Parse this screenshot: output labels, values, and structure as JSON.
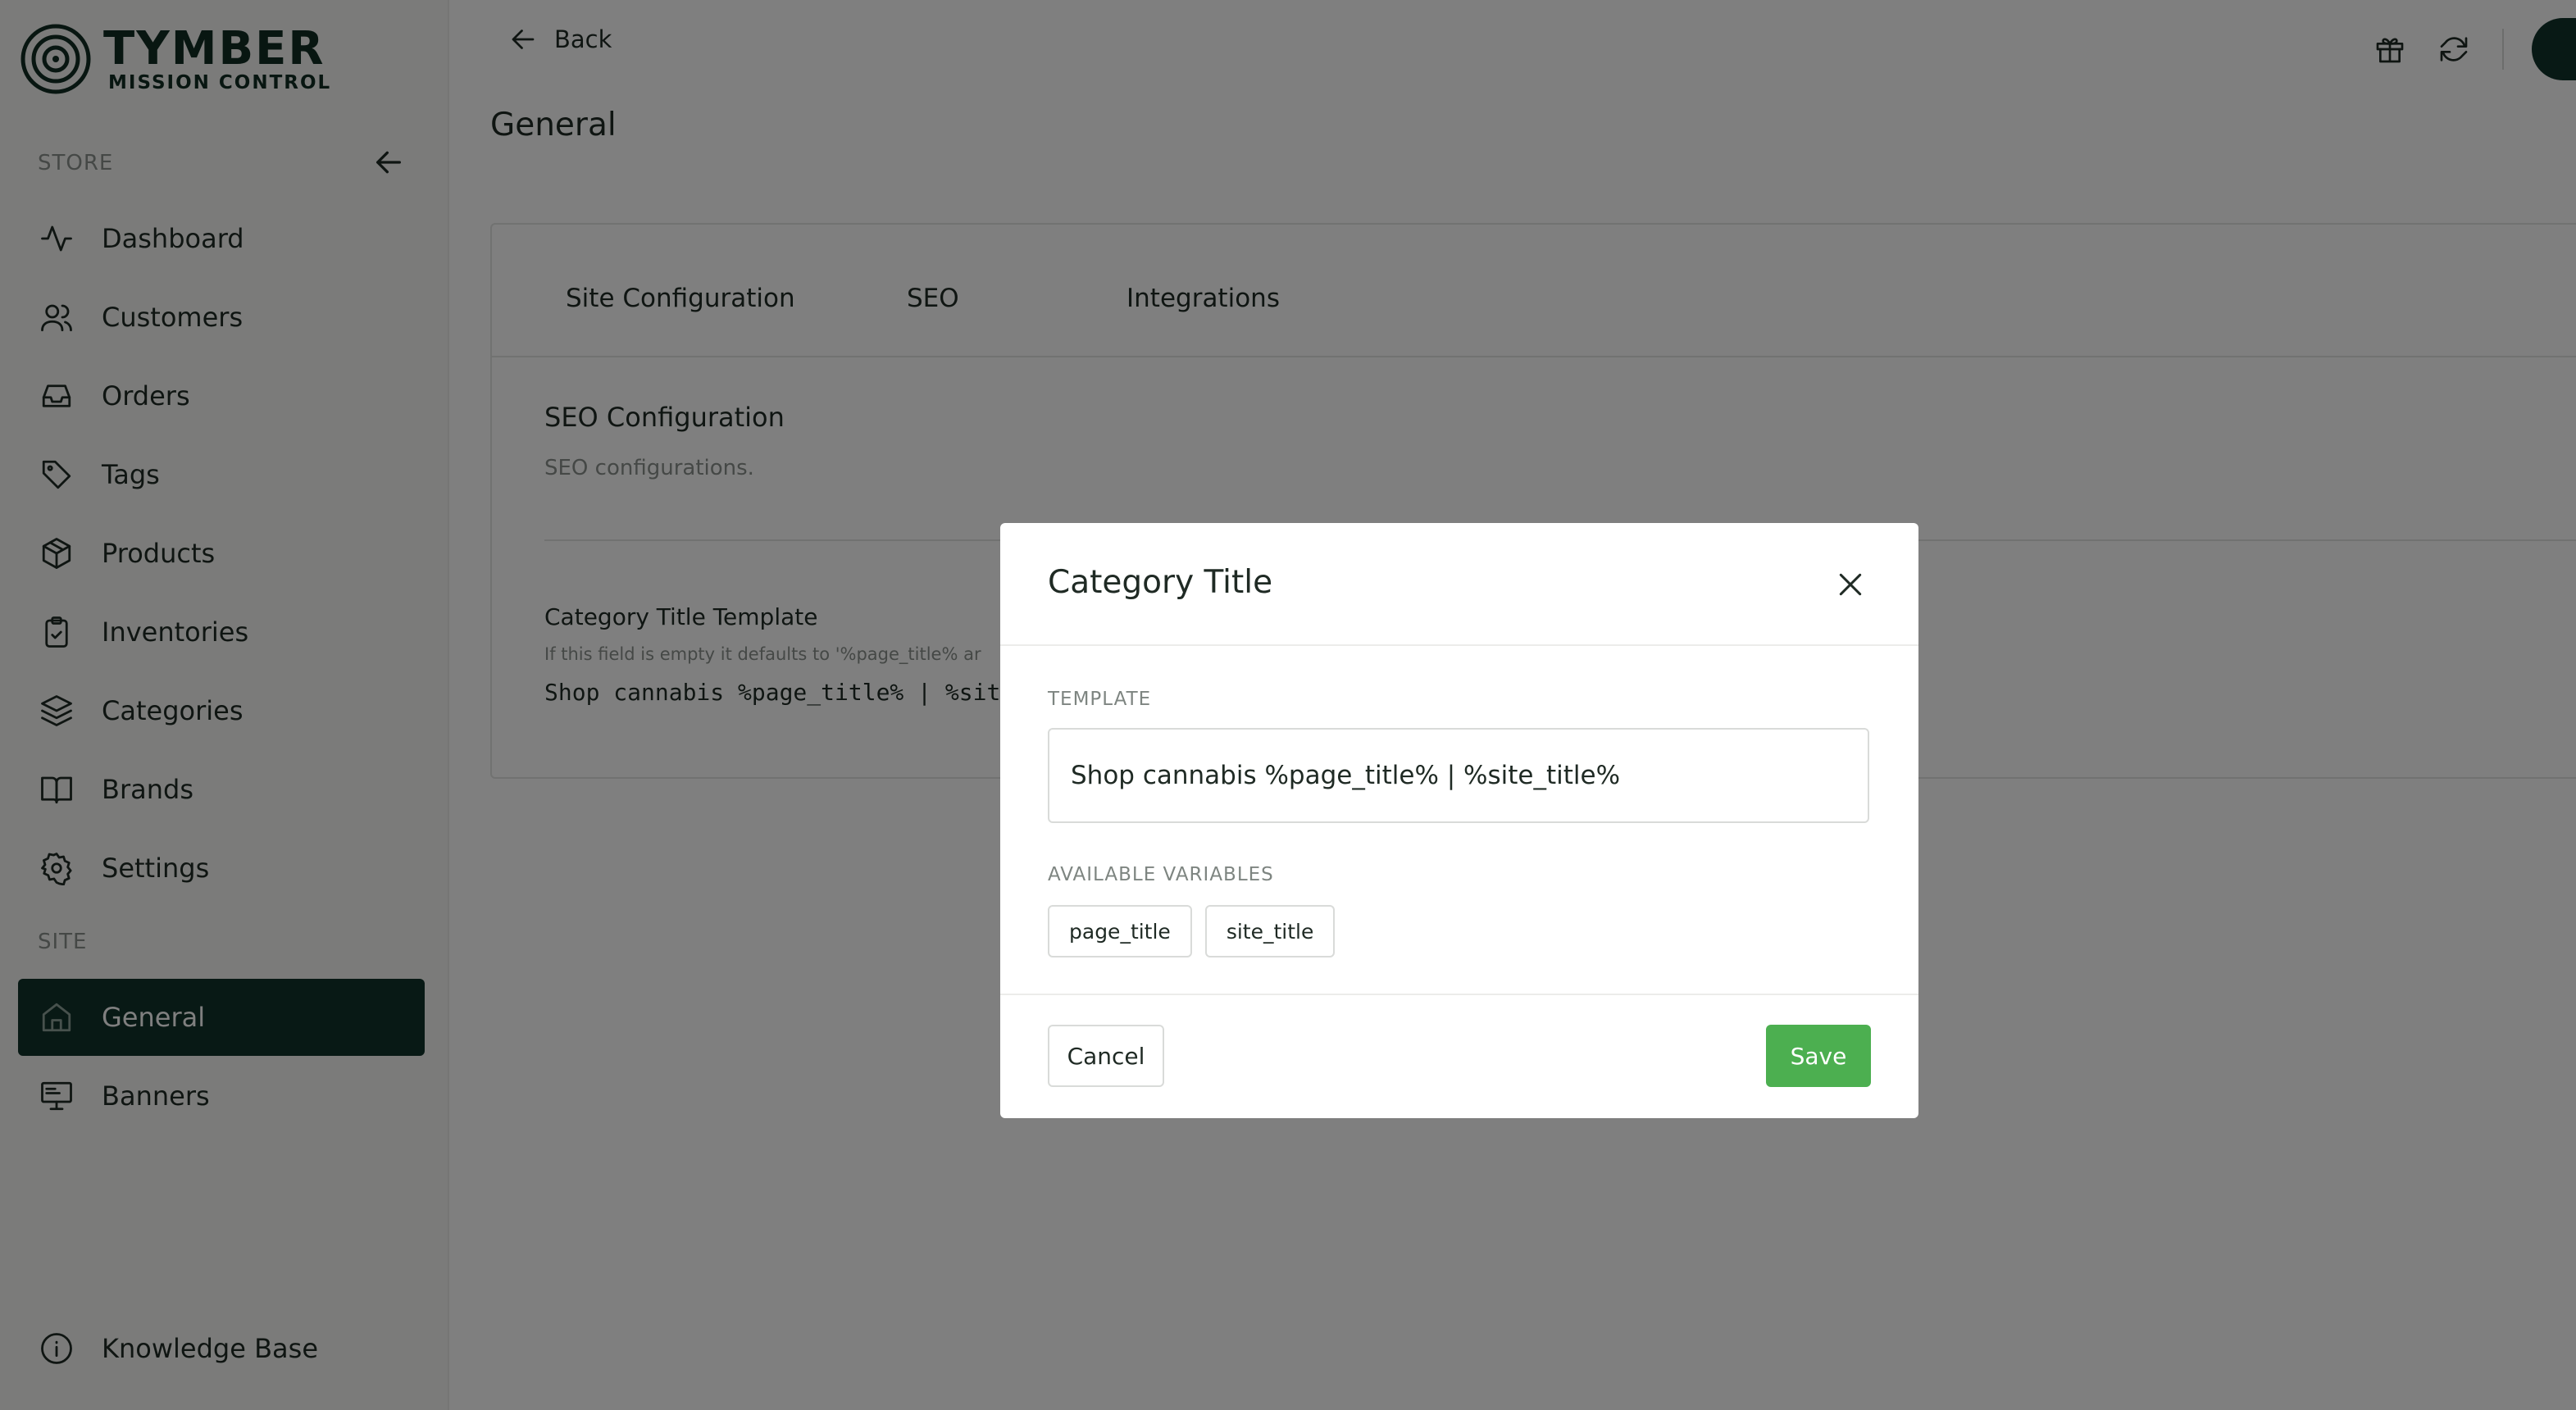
{
  "brand": {
    "title": "TYMBER",
    "subtitle": "MISSION CONTROL",
    "dark_color": "#11322a"
  },
  "sidebar": {
    "store_label": "STORE",
    "site_label": "SITE",
    "store_items": [
      {
        "label": "Dashboard",
        "icon": "activity-icon"
      },
      {
        "label": "Customers",
        "icon": "users-icon"
      },
      {
        "label": "Orders",
        "icon": "inbox-icon"
      },
      {
        "label": "Tags",
        "icon": "tag-icon"
      },
      {
        "label": "Products",
        "icon": "package-icon"
      },
      {
        "label": "Inventories",
        "icon": "clipboard-check-icon"
      },
      {
        "label": "Categories",
        "icon": "layers-icon"
      },
      {
        "label": "Brands",
        "icon": "book-open-icon"
      },
      {
        "label": "Settings",
        "icon": "gear-icon"
      }
    ],
    "site_items": [
      {
        "label": "General",
        "icon": "home-icon",
        "active": true
      },
      {
        "label": "Banners",
        "icon": "monitor-icon"
      }
    ],
    "footer_item": {
      "label": "Knowledge Base",
      "icon": "info-icon"
    }
  },
  "header": {
    "back_label": "Back",
    "page_title": "General"
  },
  "tabs": [
    {
      "label": "Site Configuration"
    },
    {
      "label": "SEO"
    },
    {
      "label": "Integrations"
    }
  ],
  "seo": {
    "title": "SEO Configuration",
    "subtitle": "SEO configurations.",
    "field_title": "Category Title Template",
    "field_hint": "If this field is empty it defaults to '%page_title% ar",
    "field_value": "Shop cannabis %page_title% | %sit"
  },
  "modal": {
    "title": "Category Title",
    "template_label": "TEMPLATE",
    "template_value": "Shop cannabis %page_title% | %site_title%",
    "variables_label": "AVAILABLE VARIABLES",
    "variables": [
      "page_title",
      "site_title"
    ],
    "cancel_label": "Cancel",
    "save_label": "Save",
    "save_color": "#4caf50"
  }
}
